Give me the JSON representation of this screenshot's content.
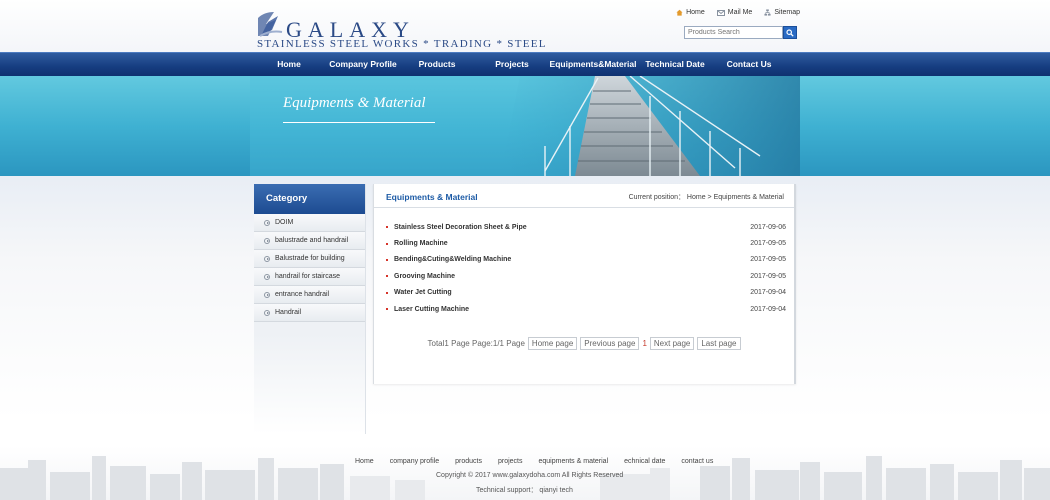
{
  "brand": {
    "name": "GALAXY",
    "tagline": "STAINLESS  STEEL WORKS  *  TRADING  *  STEEL"
  },
  "toplinks": [
    {
      "label": "Home",
      "icon": "home-icon"
    },
    {
      "label": "Mail Me",
      "icon": "mail-icon"
    },
    {
      "label": "Sitemap",
      "icon": "sitemap-icon"
    }
  ],
  "search": {
    "placeholder": "Products Search",
    "icon": "search-icon"
  },
  "nav": [
    "Home",
    "Company Profile",
    "Products",
    "Projects",
    "Equipments&Material",
    "Technical Date",
    "Contact Us"
  ],
  "banner": {
    "title": "Equipments & Material"
  },
  "sidebar": {
    "title": "Category",
    "items": [
      "DOIM",
      "balustrade and handrail",
      "Balustrade for building",
      "handrail for staircase",
      "entrance handrail",
      "Handrail"
    ]
  },
  "content": {
    "title": "Equipments & Material",
    "breadcrumb": "Current position： Home > Equipments & Material",
    "rows": [
      {
        "title": "Stainless Steel Decoration Sheet & Pipe",
        "date": "2017-09-06"
      },
      {
        "title": "Rolling Machine",
        "date": "2017-09-05"
      },
      {
        "title": "Bending&Cuting&Welding Machine",
        "date": "2017-09-05"
      },
      {
        "title": "Grooving Machine",
        "date": "2017-09-05"
      },
      {
        "title": "Water Jet Cutting",
        "date": "2017-09-04"
      },
      {
        "title": "Laser Cutting Machine",
        "date": "2017-09-04"
      }
    ],
    "pager": {
      "summary": "Total1 Page Page:1/1 Page",
      "first": "Home page",
      "prev": "Previous page",
      "current": "1",
      "next": "Next page",
      "last": "Last page"
    }
  },
  "footer": {
    "links": [
      "Home",
      "company profile",
      "products",
      "projects",
      "equipments & material",
      "echnical date",
      "contact us"
    ],
    "copyright": "Copyright © 2017 www.galaxydoha.com All Rights Reserved",
    "support": "Technical support： qianyi tech"
  },
  "colors": {
    "nav": "#163d80",
    "banner": "#3fb1d2",
    "accent": "#1d5ba6",
    "bullet": "#d6342a"
  }
}
